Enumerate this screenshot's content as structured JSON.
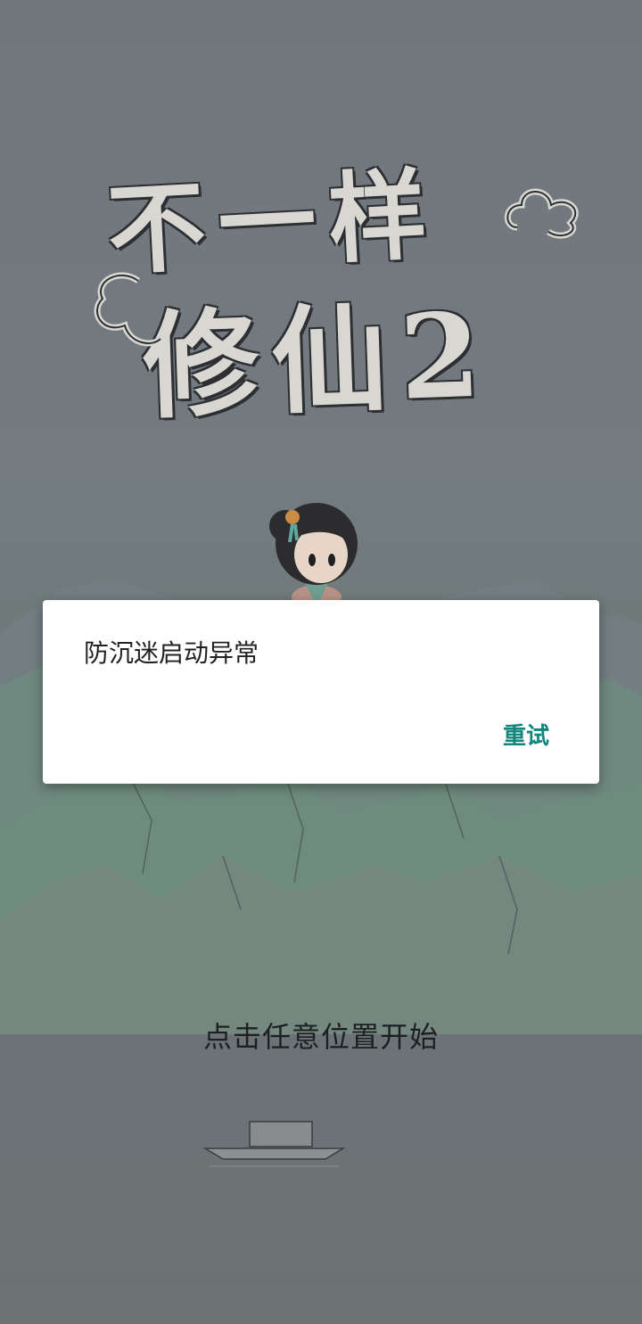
{
  "game": {
    "title_line_1": "不一样",
    "title_line_2": "修仙2",
    "start_hint": "点击任意位置开始"
  },
  "dialog": {
    "message": "防沉迷启动异常",
    "retry_label": "重试"
  },
  "colors": {
    "overlay": "#6b7278",
    "dialog_bg": "#ffffff",
    "accent": "#12857b",
    "title_fill": "#d8d7d2"
  }
}
